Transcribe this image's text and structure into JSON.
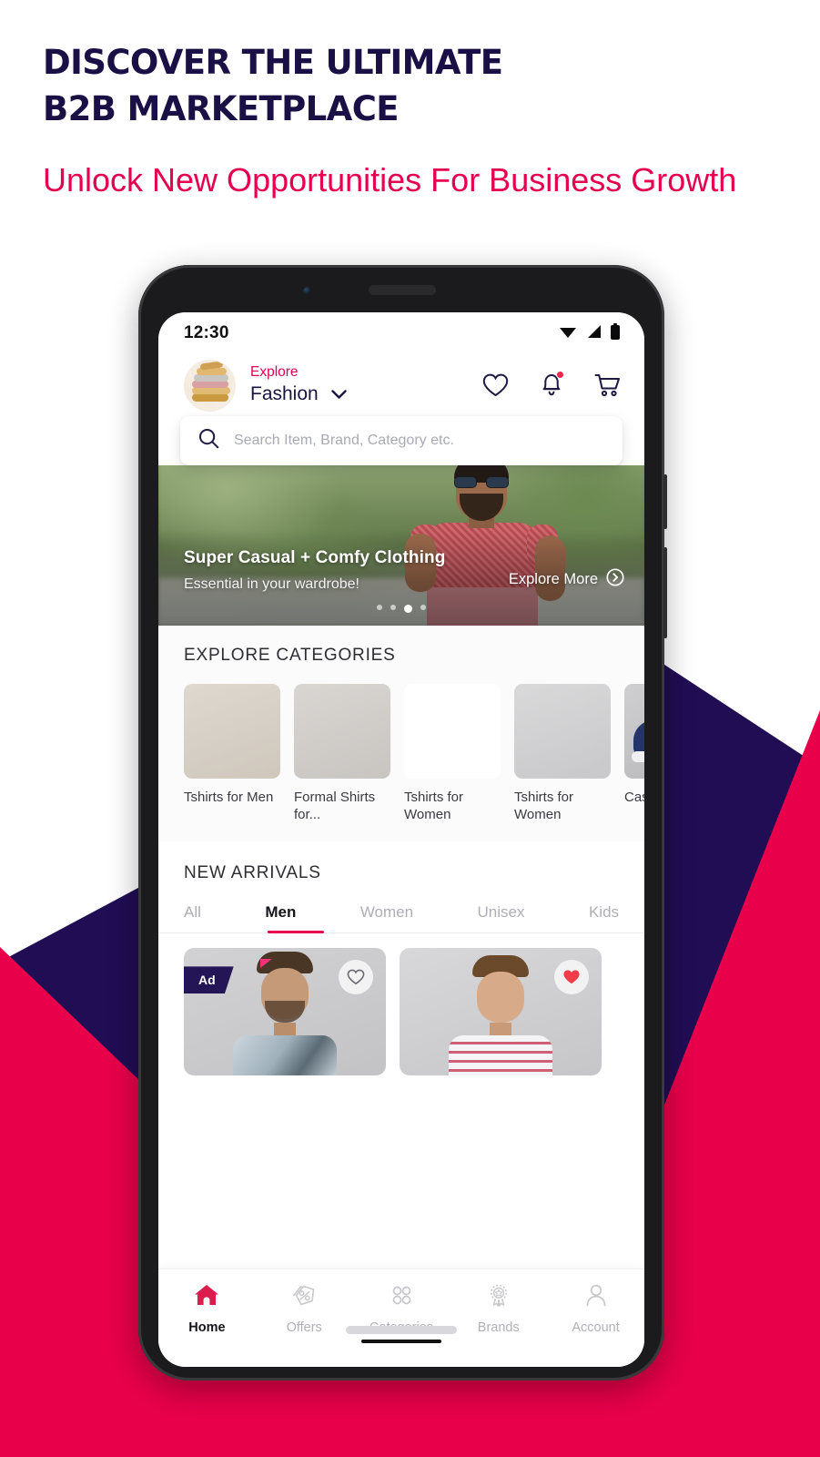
{
  "promo": {
    "headline_line1": "DISCOVER THE ULTIMATE",
    "headline_line2": "B2B MARKETPLACE",
    "subheadline": "Unlock New Opportunities For Business Growth",
    "colors": {
      "navy": "#210D54",
      "crimson": "#E8004B",
      "headline_navy": "#1B1046",
      "sub_pink": "#E4004E"
    }
  },
  "phone": {
    "status_bar": {
      "time": "12:30",
      "icons": [
        "wifi-icon",
        "cellular-signal-icon",
        "battery-icon"
      ]
    },
    "app_header": {
      "avatar": "folded-clothes-avatar",
      "kicker": "Explore",
      "category": "Fashion",
      "chevron": "chevron-down-icon",
      "actions": [
        {
          "name": "wishlist-icon",
          "label": "Wishlist",
          "badge": false
        },
        {
          "name": "notifications-icon",
          "label": "Notifications",
          "badge": true
        },
        {
          "name": "cart-icon",
          "label": "Cart",
          "badge": false
        }
      ]
    },
    "search": {
      "placeholder": "Search Item, Brand, Category etc.",
      "value": "",
      "icon": "search-icon"
    },
    "banner": {
      "title": "Super Casual + Comfy Clothing",
      "subtitle": "Essential in your wardrobe!",
      "cta": "Explore More",
      "cta_icon": "chevron-right-circle-icon",
      "dots_total": 4,
      "dots_active_index": 2
    },
    "categories": {
      "title": "EXPLORE CATEGORIES",
      "items": [
        {
          "label": "Tshirts for Men"
        },
        {
          "label": "Formal Shirts for..."
        },
        {
          "label": "Tshirts for Women"
        },
        {
          "label": "Tshirts for Women"
        },
        {
          "label": "Casual Shoes"
        }
      ]
    },
    "new_arrivals": {
      "title": "NEW ARRIVALS",
      "tabs": [
        {
          "label": "All",
          "active": false
        },
        {
          "label": "Men",
          "active": true
        },
        {
          "label": "Women",
          "active": false
        },
        {
          "label": "Unisex",
          "active": false
        },
        {
          "label": "Kids",
          "active": false
        }
      ],
      "products": [
        {
          "ad_badge": "Ad",
          "wishlisted": false,
          "heart_icon": "heart-outline-icon"
        },
        {
          "ad_badge": "",
          "wishlisted": true,
          "heart_icon": "heart-filled-icon"
        }
      ]
    },
    "bottom_nav": [
      {
        "label": "Home",
        "icon": "home-icon",
        "active": true
      },
      {
        "label": "Offers",
        "icon": "offers-tag-icon",
        "active": false
      },
      {
        "label": "Categories",
        "icon": "grid-dots-icon",
        "active": false
      },
      {
        "label": "Brands",
        "icon": "badge-star-icon",
        "active": false
      },
      {
        "label": "Account",
        "icon": "person-icon",
        "active": false
      }
    ]
  }
}
